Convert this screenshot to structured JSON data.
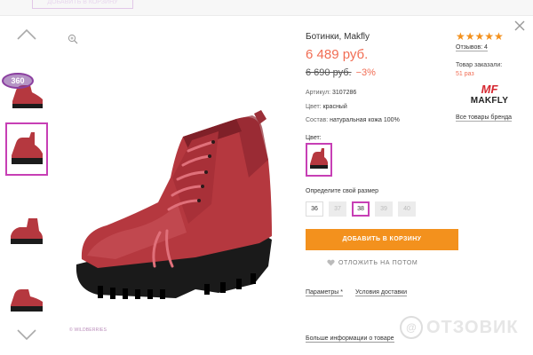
{
  "header": {
    "ghost_button_label": "ДОБАВИТЬ В КОРЗИНУ"
  },
  "gallery": {
    "thumb_360_label": "360",
    "watermark": "© WILDBERRIES"
  },
  "product": {
    "title": "Ботинки, Makfly",
    "price": "6 489 руб.",
    "old_price": "6 690 руб.",
    "discount": "−3%",
    "article_label": "Артикул:",
    "article_value": "3107286",
    "color_label": "Цвет:",
    "color_value": "красный",
    "composition_label": "Состав:",
    "composition_value": "натуральная кожа 100%",
    "color_select_label": "Цвет:",
    "size_label": "Определите свой размер",
    "sizes": [
      {
        "label": "36",
        "state": "available"
      },
      {
        "label": "37",
        "state": "unavailable"
      },
      {
        "label": "38",
        "state": "selected"
      },
      {
        "label": "39",
        "state": "unavailable"
      },
      {
        "label": "40",
        "state": "unavailable"
      }
    ],
    "add_to_cart": "ДОБАВИТЬ В КОРЗИНУ",
    "postpone": "ОТЛОЖИТЬ НА ПОТОМ",
    "params_link": "Параметры *",
    "delivery_link": "Условия доставки",
    "more_info": "Больше информации о товаре"
  },
  "sidebar": {
    "rating_stars": "★★★★★",
    "rating": 5,
    "reviews": "Отзывов: 4",
    "ordered_label": "Товар заказали:",
    "ordered_count": "51 раз",
    "brand_mark": "MF",
    "brand_name": "MAKFLY",
    "all_brand_link": "Все товары бренда"
  },
  "site_watermark": {
    "circle_letter": "@",
    "word": "ОТЗОВИК"
  },
  "colors": {
    "accent_purple": "#c73fb5",
    "price_red": "#f16d54",
    "button_orange": "#f3911d",
    "boot_red": "#b5383f",
    "brand_red": "#d5262f"
  }
}
